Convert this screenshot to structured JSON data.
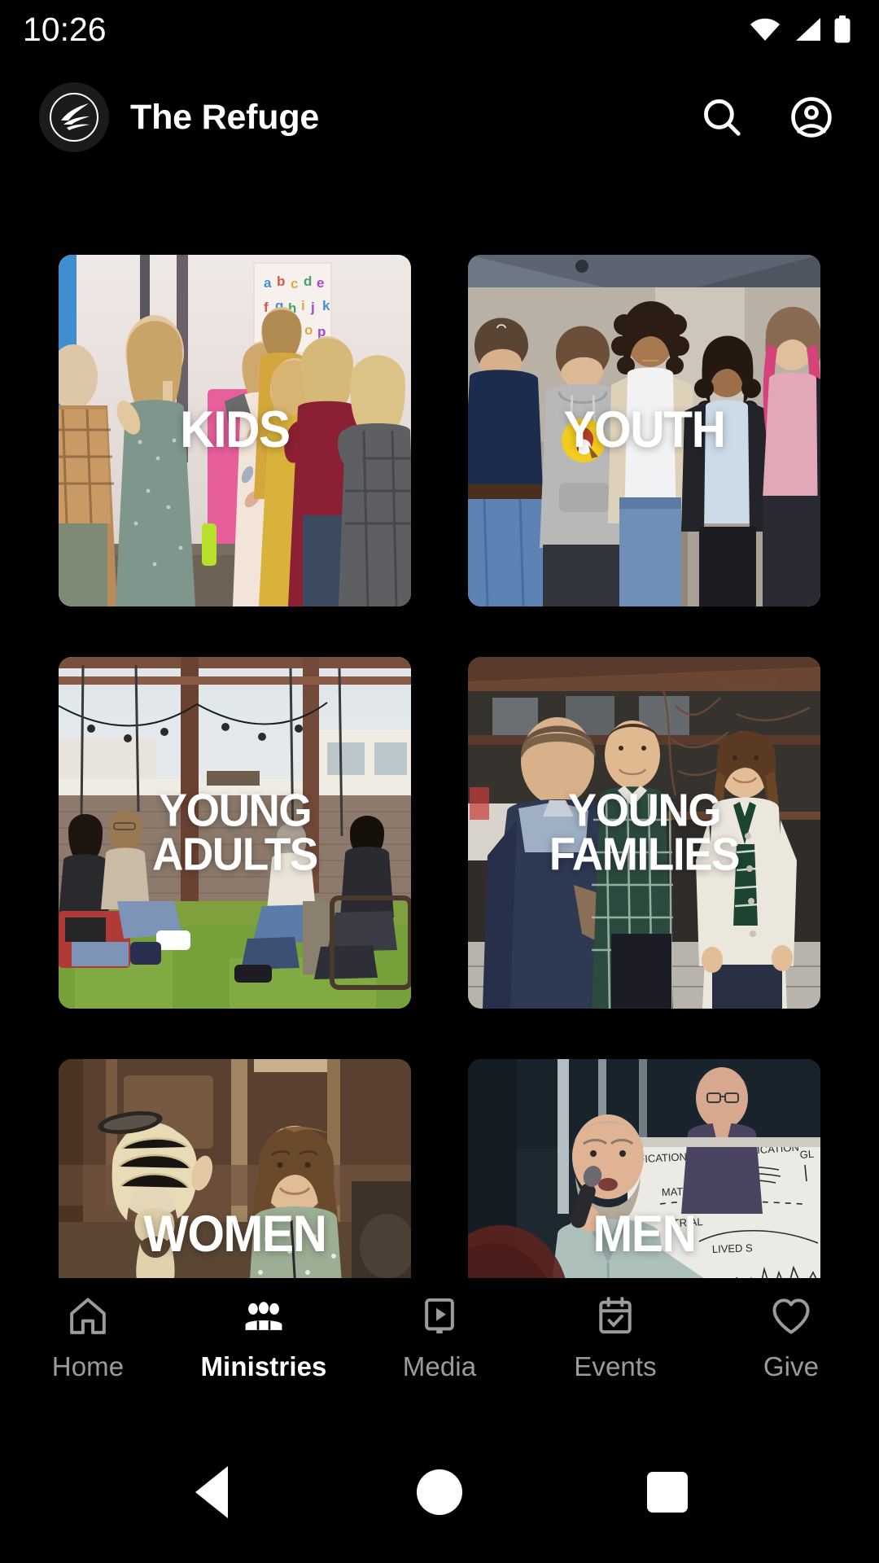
{
  "status_bar": {
    "time": "10:26",
    "icons": [
      "wifi-icon",
      "cellular-signal-icon",
      "battery-full-icon"
    ]
  },
  "header": {
    "logo_icon": "the-refuge-logo-icon",
    "title": "The Refuge",
    "actions": [
      {
        "name": "search-icon",
        "label": "Search"
      },
      {
        "name": "account-circle-icon",
        "label": "Account"
      }
    ]
  },
  "ministries": {
    "tiles": [
      {
        "label": "KIDS",
        "lines": [
          "KIDS"
        ],
        "image_alt": "children standing in a classroom with alphabet poster"
      },
      {
        "label": "YOUTH",
        "lines": [
          "YOUTH"
        ],
        "image_alt": "group of teenage girls smiling under a canopy"
      },
      {
        "label": "YOUNG ADULTS",
        "lines": [
          "YOUNG",
          "ADULTS"
        ],
        "image_alt": "young adults sitting on swings and chairs on grass under string lights"
      },
      {
        "label": "YOUNG FAMILIES",
        "lines": [
          "YOUNG",
          "FAMILIES"
        ],
        "image_alt": "three adults talking outside a building"
      },
      {
        "label": "WOMEN",
        "lines": [
          "WOMEN"
        ],
        "image_alt": "two women talking and smiling indoors"
      },
      {
        "label": "MEN",
        "lines": [
          "MEN"
        ],
        "image_alt": "man speaking into a microphone in front of a whiteboard"
      }
    ]
  },
  "bottom_nav": {
    "active": "Ministries",
    "items": [
      {
        "label": "Home",
        "icon": "home-icon",
        "active": false
      },
      {
        "label": "Ministries",
        "icon": "people-group-icon",
        "active": true
      },
      {
        "label": "Media",
        "icon": "media-play-icon",
        "active": false
      },
      {
        "label": "Events",
        "icon": "calendar-check-icon",
        "active": false
      },
      {
        "label": "Give",
        "icon": "heart-icon",
        "active": false
      }
    ]
  },
  "system_nav": {
    "buttons": [
      {
        "name": "android-back-button",
        "icon": "triangle-back-icon"
      },
      {
        "name": "android-home-button",
        "icon": "circle-home-icon"
      },
      {
        "name": "android-recents-button",
        "icon": "square-recents-icon"
      }
    ]
  },
  "colors": {
    "background": "#000000",
    "text_primary": "#ffffff",
    "text_inactive": "#9b9b9b",
    "logo_badge": "#1b1b1b"
  }
}
